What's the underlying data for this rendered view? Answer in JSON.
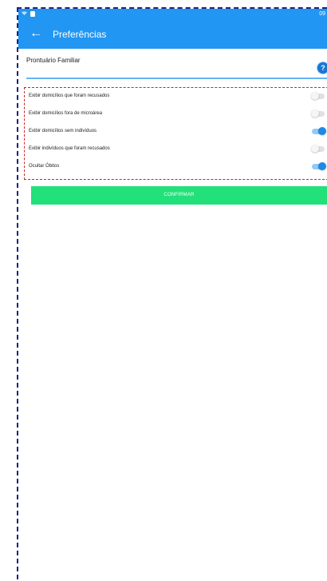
{
  "status_bar": {
    "time": "09"
  },
  "header": {
    "title": "Preferências"
  },
  "section": {
    "label": "Prontuário Familiar",
    "help_symbol": "?"
  },
  "options": [
    {
      "label": "Exibir domicílios que foram recusados",
      "enabled": false
    },
    {
      "label": "Exibir domicílios fora de microárea",
      "enabled": false
    },
    {
      "label": "Exibir domicílios sem indivíduos",
      "enabled": true
    },
    {
      "label": "Exibir indivíduos que foram recusados",
      "enabled": false
    },
    {
      "label": "Ocultar Óbitos",
      "enabled": true
    }
  ],
  "actions": {
    "confirm_label": "CONFIRMAR"
  },
  "icons": {
    "back": "arrow-left-icon",
    "help": "help-icon",
    "wifi": "wifi-icon",
    "notification": "notification-icon"
  },
  "colors": {
    "primary": "#2196f3",
    "confirm": "#22e07a",
    "switch_on": "#1e88e5"
  }
}
